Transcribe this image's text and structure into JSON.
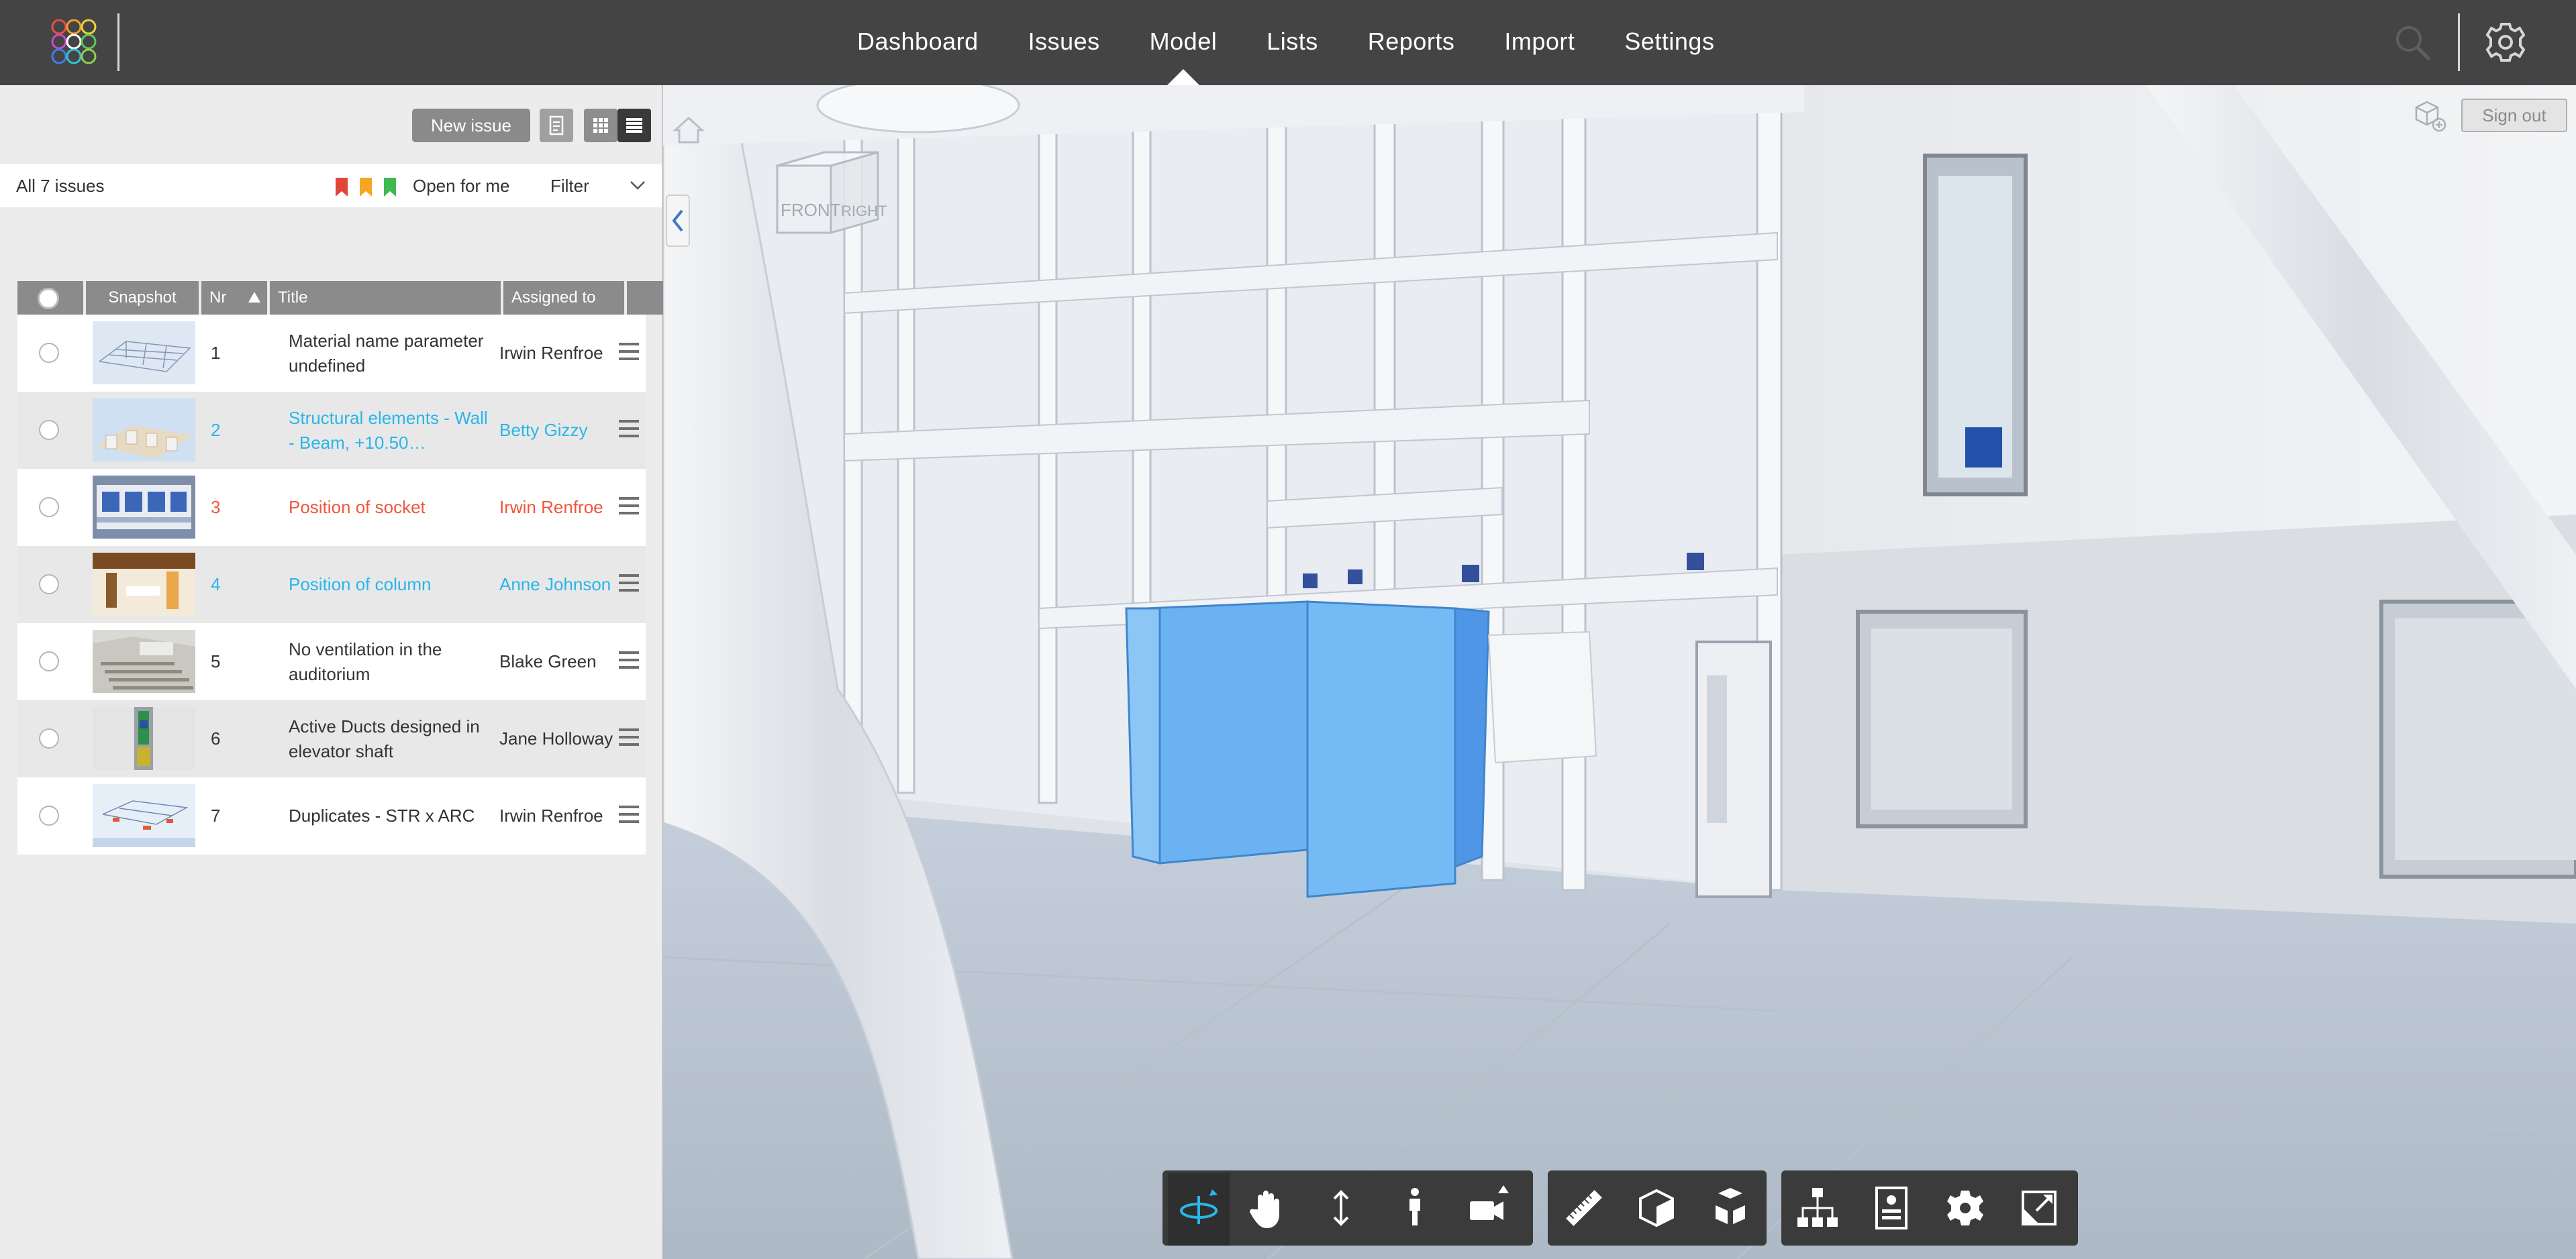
{
  "nav": {
    "items": [
      {
        "label": "Dashboard"
      },
      {
        "label": "Issues"
      },
      {
        "label": "Model",
        "active": true
      },
      {
        "label": "Lists"
      },
      {
        "label": "Reports"
      },
      {
        "label": "Import"
      },
      {
        "label": "Settings"
      }
    ],
    "icons": [
      "logo-icon",
      "search-icon",
      "gear-icon"
    ]
  },
  "panel": {
    "new_issue_label": "New issue",
    "view_toggle_icons": [
      "document-icon",
      "grid-view-icon",
      "list-view-icon"
    ],
    "issues_count": "All 7 issues",
    "flags": [
      "#e0453a",
      "#f5a623",
      "#3fb950"
    ],
    "open_for_me": "Open for me",
    "filter_label": "Filter"
  },
  "table": {
    "headers": {
      "snapshot": "Snapshot",
      "nr": "Nr",
      "title": "Title",
      "assigned": "Assigned to"
    },
    "sort_indicator": "ascending",
    "rows": [
      {
        "nr": "1",
        "title": "Material name parameter undefined",
        "assigned": "Irwin Renfroe",
        "color": "default"
      },
      {
        "nr": "2",
        "title": "Structural elements - Wall - Beam, +10.50…",
        "assigned": "Betty Gizzy",
        "color": "blue"
      },
      {
        "nr": "3",
        "title": "Position of socket",
        "assigned": "Irwin Renfroe",
        "color": "red"
      },
      {
        "nr": "4",
        "title": "Position of column",
        "assigned": "Anne Johnson",
        "color": "blue"
      },
      {
        "nr": "5",
        "title": "No ventilation in the auditorium",
        "assigned": "Blake Green",
        "color": "default"
      },
      {
        "nr": "6",
        "title": "Active Ducts designed in elevator shaft",
        "assigned": "Jane Holloway",
        "color": "default"
      },
      {
        "nr": "7",
        "title": "Duplicates - STR x ARC",
        "assigned": "Irwin Renfroe",
        "color": "default"
      }
    ]
  },
  "viewport": {
    "signout_label": "Sign out",
    "navcube": {
      "front": "FRONT",
      "right": "RIGHT"
    },
    "highlight_color": "#6ab2f2"
  },
  "toolbar": {
    "groups": [
      [
        "orbit-icon",
        "pan-hand-icon",
        "vertical-move-icon",
        "walk-person-icon",
        "camera-icon"
      ],
      [
        "ruler-icon",
        "section-box-icon",
        "exploded-cube-icon"
      ],
      [
        "hierarchy-tree-icon",
        "properties-panel-icon",
        "settings-gear-icon",
        "fullscreen-icon"
      ]
    ]
  },
  "colors": {
    "topbar": "#444444",
    "accent_blue": "#29b6e8",
    "accent_red": "#f0553d"
  }
}
